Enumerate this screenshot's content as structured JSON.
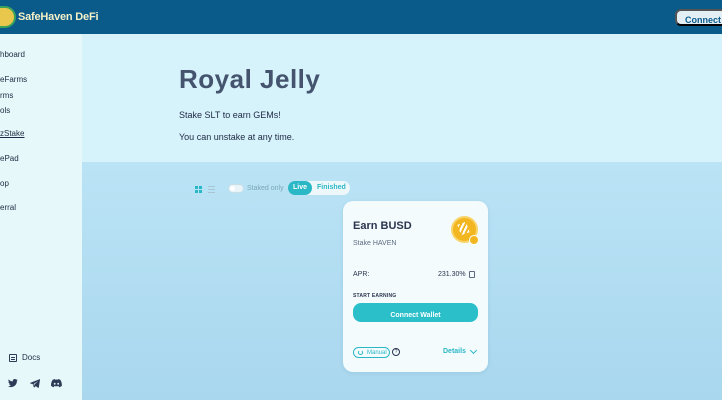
{
  "app": {
    "logo_text": "SafeHaven DeFi",
    "connect_top": "Connect Wallet"
  },
  "sidebar": {
    "items": [
      {
        "label": "hboard",
        "icon": "dashboard-icon"
      },
      {
        "label": "eFarms",
        "icon": "farm-icon"
      },
      {
        "label": "rms",
        "icon": "farm-icon"
      },
      {
        "label": "ols",
        "icon": "pool-icon"
      },
      {
        "label": "zStake",
        "icon": "stake-icon"
      },
      {
        "label": "ePad",
        "icon": "launchpad-icon"
      },
      {
        "label": "op",
        "icon": "shop-icon"
      },
      {
        "label": "erral",
        "icon": "referral-icon"
      }
    ],
    "docs_label": "Docs",
    "social": [
      "twitter-icon",
      "telegram-icon",
      "discord-icon"
    ]
  },
  "hero": {
    "title": "Royal Jelly",
    "line1": "Stake SLT to earn GEMs!",
    "line2": "You can unstake at any time."
  },
  "filters": {
    "staked_only": "Staked only",
    "live": "Live",
    "finished": "Finished"
  },
  "card": {
    "title": "Earn BUSD",
    "subtitle": "Stake HAVEN",
    "apr_label": "APR:",
    "apr_value": "231.30%",
    "start_label": "START EARNING",
    "connect_label": "Connect Wallet",
    "manual_label": "Manual",
    "details_label": "Details"
  },
  "colors": {
    "accent": "#2bb8c6",
    "topbar": "#0a5a8a",
    "title": "#44546e"
  }
}
